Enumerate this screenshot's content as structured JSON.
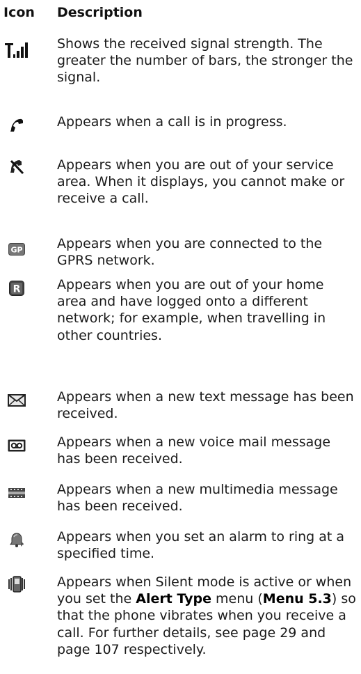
{
  "header": {
    "icon_col": "Icon",
    "desc_col": "Description"
  },
  "rows": [
    {
      "icon": "signal-strength-icon",
      "text": "Shows the received signal strength. The greater the number of bars, the stronger the signal."
    },
    {
      "icon": "call-in-progress-icon",
      "text": "Appears when a call is in progress."
    },
    {
      "icon": "no-service-icon",
      "text": "Appears when you are out of your service area. When it displays, you cannot make or receive a call."
    },
    {
      "icon": "gprs-icon",
      "text": "Appears when you are connected to the GPRS network."
    },
    {
      "icon": "roaming-icon",
      "text": "Appears when you are out of your home area and have logged onto a different network; for example, when travelling in other countries."
    },
    {
      "icon": "new-text-message-icon",
      "text": "Appears when a new text message has been received."
    },
    {
      "icon": "voice-mail-icon",
      "text": "Appears when a new voice mail message has been received."
    },
    {
      "icon": "multimedia-message-icon",
      "text": "Appears when a new multimedia message has been received."
    },
    {
      "icon": "alarm-icon",
      "text": "Appears when you set an alarm to ring at a specified time."
    },
    {
      "icon": "silent-mode-vibrate-icon",
      "text_before": "Appears when Silent mode is active or when you set the ",
      "bold_1": "Alert Type",
      "text_mid": " menu (",
      "bold_2": "Menu 5.3",
      "text_after": ") so that the phone vibrates when you receive a call. For further details, see page 29 and page 107 respectively."
    }
  ]
}
